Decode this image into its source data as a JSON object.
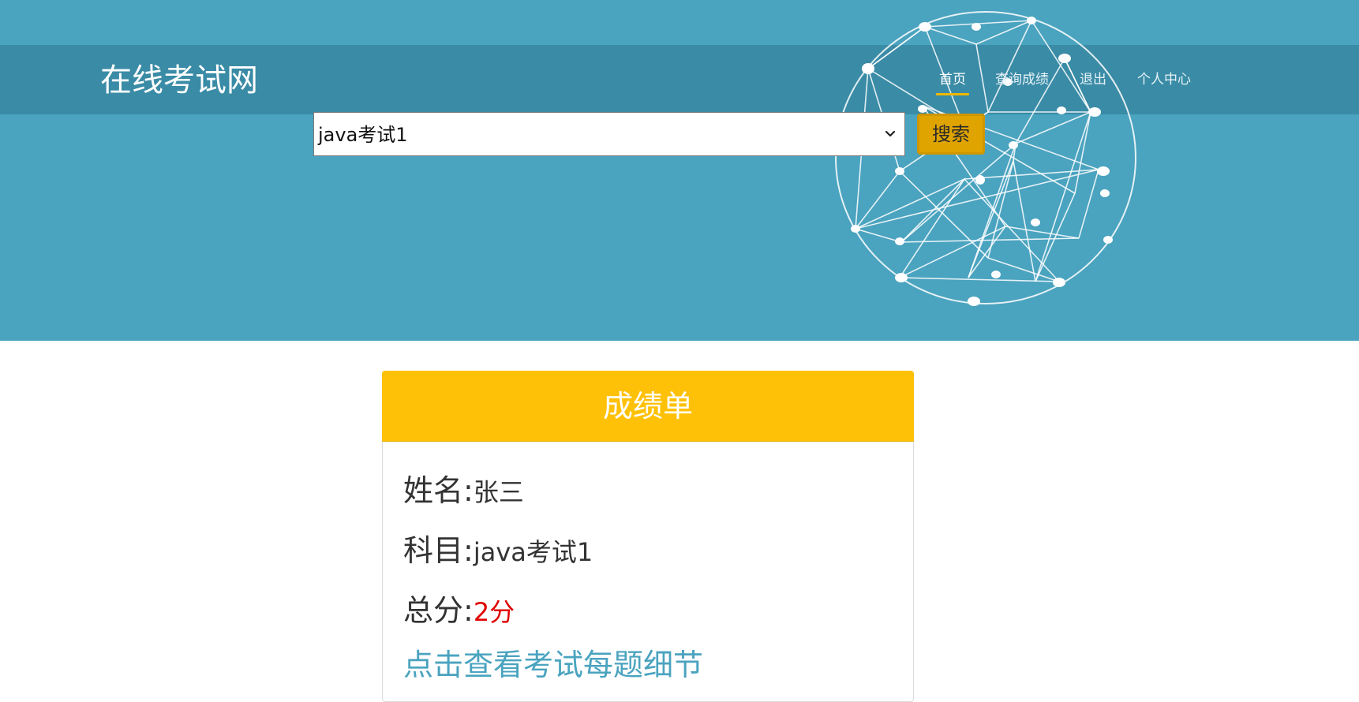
{
  "header": {
    "brand": "在线考试网",
    "nav": [
      {
        "label": "首页",
        "active": true
      },
      {
        "label": "查询成绩",
        "active": false
      },
      {
        "label": "退出",
        "active": false
      },
      {
        "label": "个人中心",
        "active": false
      }
    ]
  },
  "search": {
    "selected_exam": "java考试1",
    "button_label": "搜索"
  },
  "score_card": {
    "title": "成绩单",
    "name_label": "姓名:",
    "name_value": "张三",
    "subject_label": "科目:",
    "subject_value": "java考试1",
    "total_label": "总分:",
    "total_value": "2分",
    "detail_link": "点击查看考试每题细节"
  },
  "colors": {
    "hero_bg": "#4aa3bf",
    "accent": "#ffc107",
    "score_red": "#e00000"
  },
  "icons": {
    "select_arrow": "chevron-down-icon",
    "decoration": "network-globe"
  }
}
